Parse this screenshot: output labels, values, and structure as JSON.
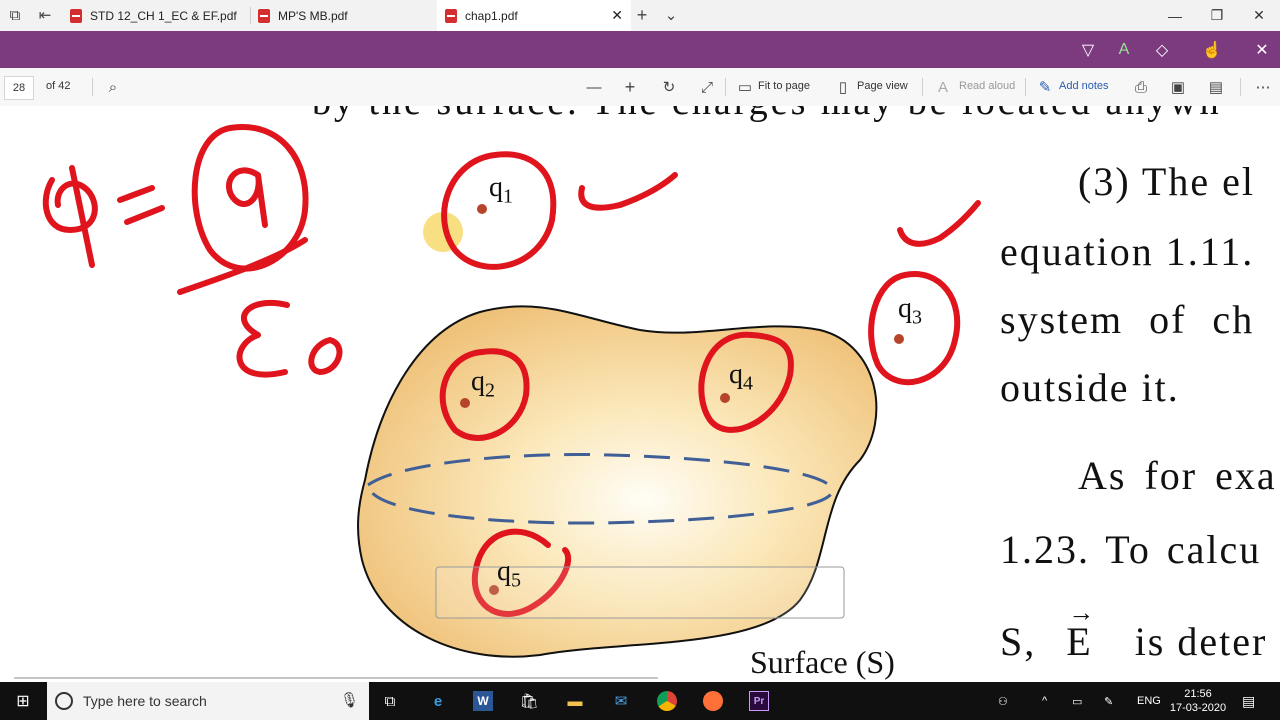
{
  "tabs": [
    {
      "label": "STD 12_CH 1_EC & EF.pdf"
    },
    {
      "label": "MP'S MB.pdf"
    },
    {
      "label": "chap1.pdf"
    }
  ],
  "toolbar": {
    "page_number": "28",
    "page_total": "of 42",
    "fit_to_page": "Fit to page",
    "page_view": "Page view",
    "read_aloud": "Read aloud",
    "add_notes": "Add notes"
  },
  "document": {
    "top_line": "by the surface. The charges may be located anywh",
    "para_line1": "(3) The el",
    "para_line2": "equation 1.11.",
    "para_line3": "system of ch",
    "para_line4": "outside it.",
    "para_line5": "As for exa",
    "para_line6": "1.23. To calcu",
    "para_line7_s": "S,",
    "para_line7_e": "E",
    "para_line7_rest": "is deter",
    "surface_label": "Surface (S)",
    "charges": [
      {
        "q": "q",
        "sub": "1"
      },
      {
        "q": "q",
        "sub": "2"
      },
      {
        "q": "q",
        "sub": "3"
      },
      {
        "q": "q",
        "sub": "4"
      },
      {
        "q": "q",
        "sub": "5"
      }
    ]
  },
  "taskbar": {
    "search_placeholder": "Type here to search",
    "language": "ENG",
    "time": "21:56",
    "date": "17-03-2020"
  },
  "colors": {
    "accent_purple": "#7c3a7f",
    "ink_red": "#e0141c",
    "surface_fill": "#f3cf86",
    "dashed_blue": "#3f5f96"
  }
}
